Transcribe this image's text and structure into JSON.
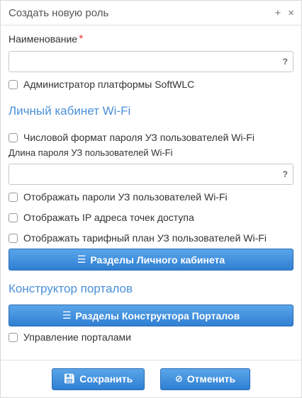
{
  "dialog": {
    "title": "Создать новую роль",
    "add_icon": "+",
    "close_icon": "×"
  },
  "name_field": {
    "label": "Наименование",
    "required_mark": "*",
    "value": "",
    "help": "?"
  },
  "admin_checkbox": {
    "label": "Администратор платформы SoftWLC"
  },
  "cabinet_section": {
    "title": "Личный кабинет Wi-Fi",
    "numeric_password_checkbox": "Числовой формат пароля УЗ пользователей Wi-Fi",
    "password_length_label": "Длина пароля УЗ пользователей Wi-Fi",
    "password_length_value": "",
    "password_length_help": "?",
    "show_passwords_checkbox": "Отображать пароли УЗ пользователей Wi-Fi",
    "show_ap_ip_checkbox": "Отображать IP адреса точек доступа",
    "show_tariff_checkbox": "Отображать тарифный план УЗ пользователей Wi-Fi",
    "sections_button": "Разделы Личного кабинета"
  },
  "constructor_section": {
    "title": "Конструктор порталов",
    "sections_button": "Разделы Конструктора Порталов",
    "manage_portals_checkbox": "Управление порталами"
  },
  "footer": {
    "save_label": "Сохранить",
    "cancel_label": "Отменить"
  },
  "colors": {
    "accent": "#4a90d9",
    "button": "#3a8ad8",
    "required": "#e53935"
  }
}
